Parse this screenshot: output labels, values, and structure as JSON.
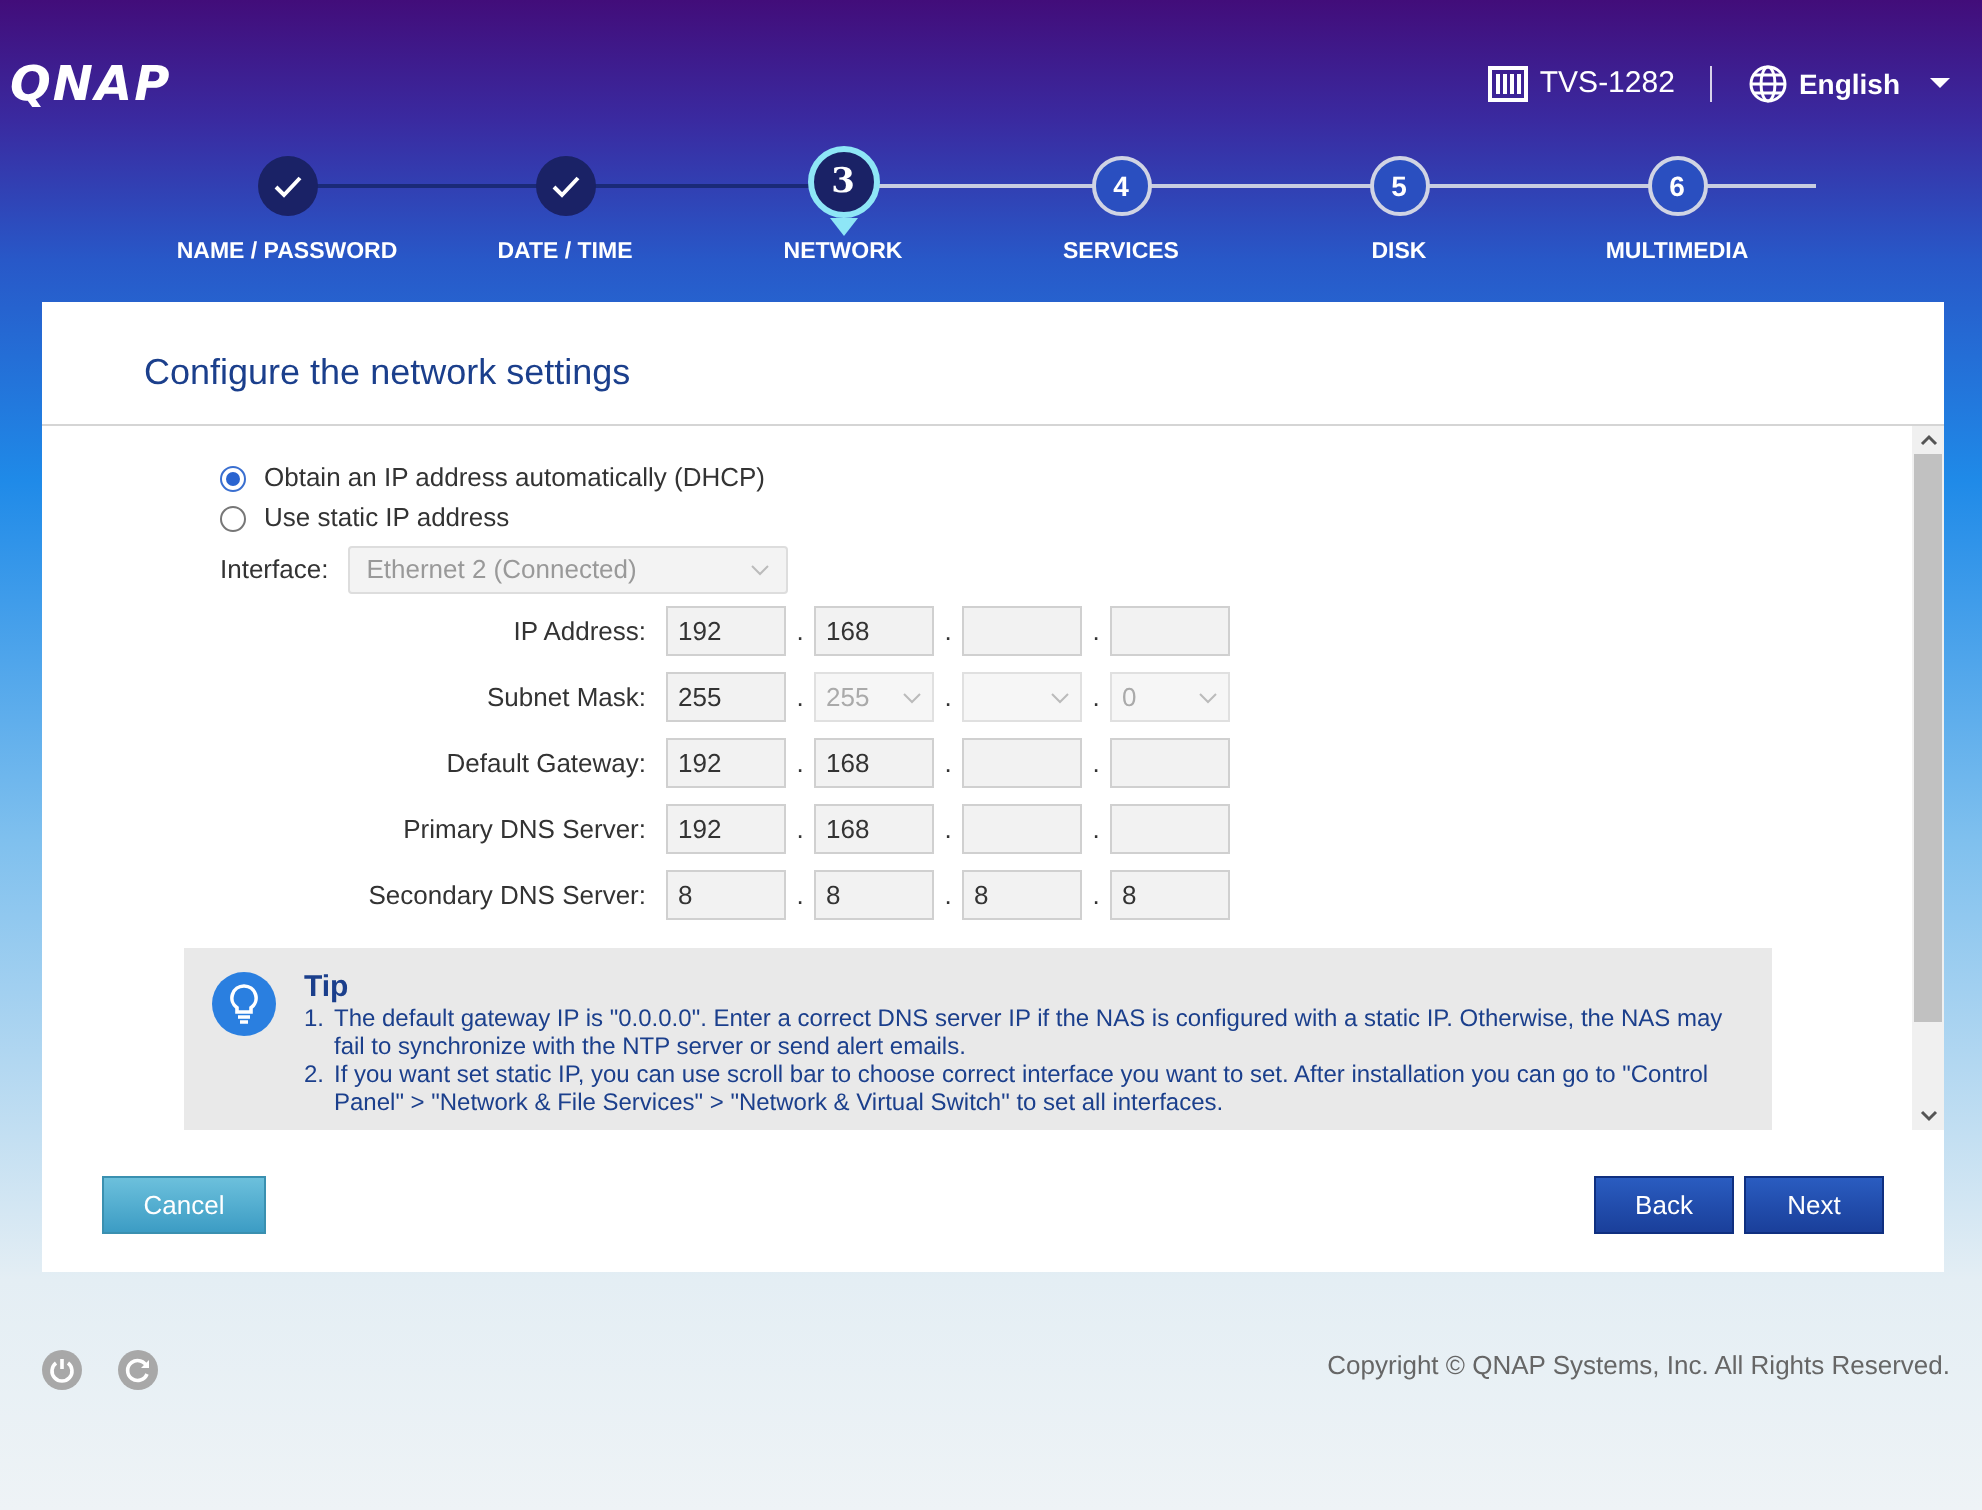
{
  "header": {
    "logo": "QNAP",
    "device": "TVS-1282",
    "language": "English"
  },
  "steps": [
    {
      "label": "NAME / PASSWORD",
      "completed": true,
      "selected": false
    },
    {
      "label": "DATE / TIME",
      "completed": true,
      "selected": false
    },
    {
      "number": "3",
      "label": "NETWORK",
      "completed": false,
      "selected": true
    },
    {
      "number": "4",
      "label": "SERVICES",
      "completed": false,
      "selected": false
    },
    {
      "number": "5",
      "label": "DISK",
      "completed": false,
      "selected": false
    },
    {
      "number": "6",
      "label": "MULTIMEDIA",
      "completed": false,
      "selected": false
    }
  ],
  "panel": {
    "title": "Configure the network settings",
    "radios": [
      {
        "label": "Obtain an IP address automatically (DHCP)",
        "selected": true
      },
      {
        "label": "Use static IP address",
        "selected": false
      }
    ],
    "interface": {
      "label": "Interface:",
      "value": "Ethernet 2 (Connected)",
      "disabled": true
    },
    "fields": [
      {
        "label": "IP Address:",
        "octets": [
          {
            "kind": "input",
            "value": "192"
          },
          {
            "separator": ".",
            "kind": "input",
            "value": "168"
          },
          {
            "separator": ".",
            "kind": "input"
          },
          {
            "separator": ".",
            "kind": "input"
          }
        ]
      },
      {
        "label": "Subnet Mask:",
        "octets": [
          {
            "kind": "input",
            "value": "255"
          },
          {
            "separator": ".",
            "kind": "select",
            "value": "255"
          },
          {
            "separator": ".",
            "kind": "select"
          },
          {
            "separator": ".",
            "kind": "select",
            "value": "0"
          }
        ]
      },
      {
        "label": "Default Gateway:",
        "octets": [
          {
            "kind": "input",
            "value": "192"
          },
          {
            "separator": ".",
            "kind": "input",
            "value": "168"
          },
          {
            "separator": ".",
            "kind": "input"
          },
          {
            "separator": ".",
            "kind": "input"
          }
        ]
      },
      {
        "label": "Primary DNS Server:",
        "octets": [
          {
            "kind": "input",
            "value": "192"
          },
          {
            "separator": ".",
            "kind": "input",
            "value": "168"
          },
          {
            "separator": ".",
            "kind": "input"
          },
          {
            "separator": ".",
            "kind": "input"
          }
        ]
      },
      {
        "label": "Secondary DNS Server:",
        "octets": [
          {
            "kind": "input",
            "value": "8"
          },
          {
            "separator": ".",
            "kind": "input",
            "value": "8"
          },
          {
            "separator": ".",
            "kind": "input",
            "value": "8"
          },
          {
            "separator": ".",
            "kind": "input",
            "value": "8"
          }
        ]
      }
    ],
    "tip": {
      "title": "Tip",
      "items": [
        {
          "number": "1.",
          "text": "The default gateway IP is \"0.0.0.0\". Enter a correct DNS server IP if the NAS is configured with a static IP. Otherwise, the NAS may fail to synchronize with the NTP server or send alert emails."
        },
        {
          "number": "2.",
          "text": "If you want set static IP, you can use scroll bar to choose correct interface you want to set. After installation you can go to \"Control Panel\" > \"Network & File Services\" > \"Network & Virtual Switch\" to set all interfaces."
        }
      ]
    },
    "buttons": {
      "cancel": "Cancel",
      "back": "Back",
      "next": "Next"
    }
  },
  "footer": {
    "copyright": "Copyright © QNAP Systems, Inc. All Rights Reserved."
  }
}
